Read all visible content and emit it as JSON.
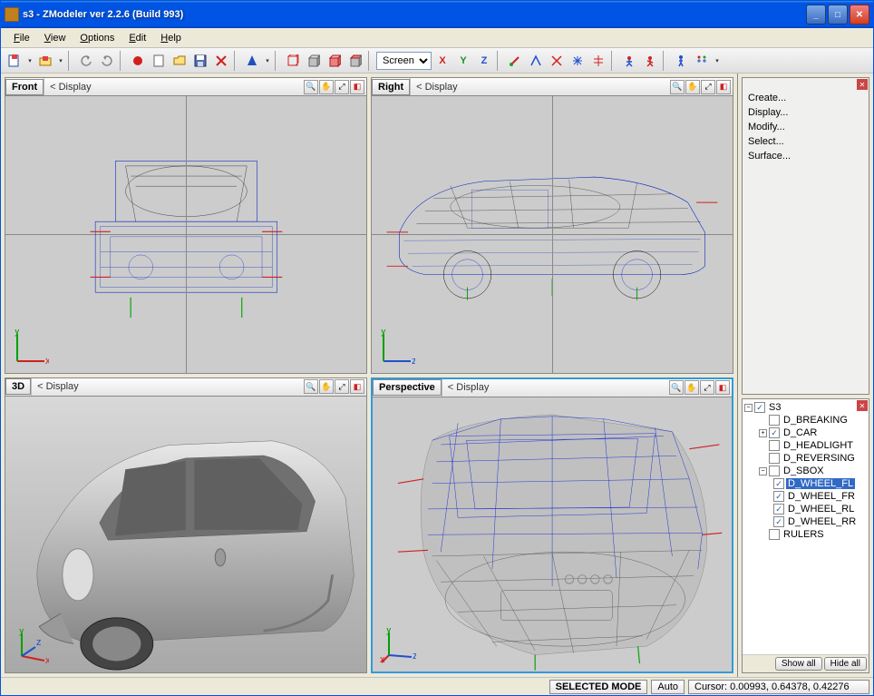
{
  "window": {
    "title": "s3 - ZModeler ver 2.2.6 (Build 993)"
  },
  "menubar": {
    "file": "File",
    "view": "View",
    "options": "Options",
    "edit": "Edit",
    "help": "Help"
  },
  "toolbar": {
    "screen_combo": "Screen",
    "x": "X",
    "y": "Y",
    "z": "Z"
  },
  "viewports": {
    "front": {
      "label": "Front",
      "display": "Display"
    },
    "right": {
      "label": "Right",
      "display": "Display"
    },
    "threeD": {
      "label": "3D",
      "display": "Display"
    },
    "perspective": {
      "label": "Perspective",
      "display": "Display"
    },
    "display_prefix": "<"
  },
  "actions": {
    "create": "Create...",
    "display": "Display...",
    "modify": "Modify...",
    "select": "Select...",
    "surface": "Surface..."
  },
  "tree": {
    "root": "S3",
    "items": {
      "breaking": "D_BREAKING",
      "car": "D_CAR",
      "headlight": "D_HEADLIGHT",
      "reversing": "D_REVERSING",
      "sbox": "D_SBOX",
      "wheel_fl": "D_WHEEL_FL",
      "wheel_fr": "D_WHEEL_FR",
      "wheel_rl": "D_WHEEL_RL",
      "wheel_rr": "D_WHEEL_RR",
      "rulers": "RULERS"
    },
    "show_all": "Show all",
    "hide_all": "Hide all"
  },
  "status": {
    "selected_mode": "SELECTED MODE",
    "auto": "Auto",
    "cursor": "Cursor: 0.00993, 0.64378, 0.42276"
  }
}
